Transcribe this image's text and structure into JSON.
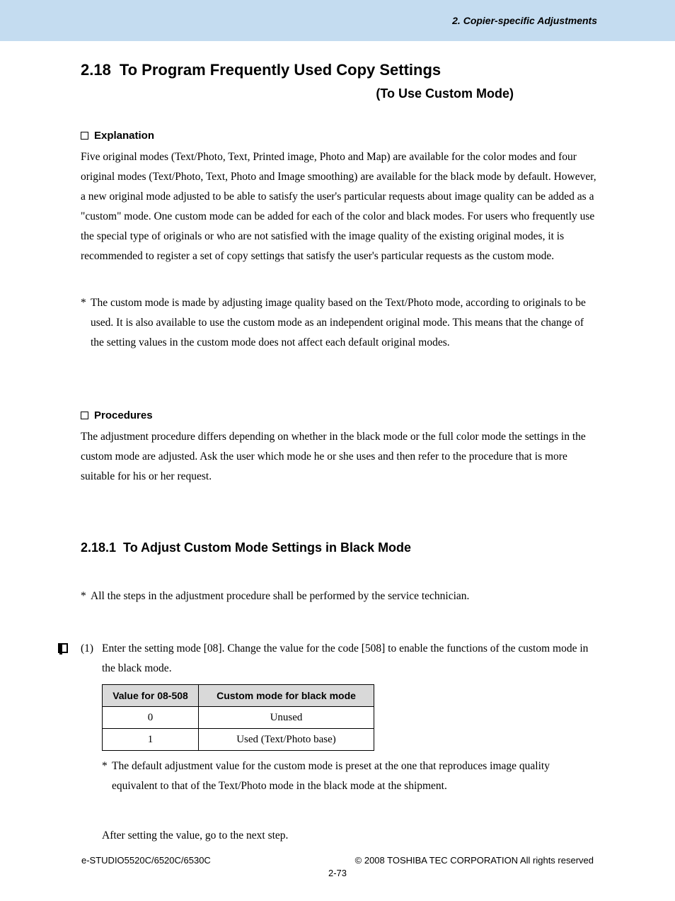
{
  "header": {
    "chapter": "2. Copier-specific Adjustments"
  },
  "title": {
    "number": "2.18",
    "text": "To Program Frequently Used Copy Settings",
    "subtitle": "(To Use Custom Mode)"
  },
  "explanation": {
    "label": "Explanation",
    "para": "Five original modes (Text/Photo, Text, Printed image, Photo and Map) are available for the color modes and four original modes (Text/Photo, Text, Photo and Image smoothing) are available for the black mode by default. However, a new original mode adjusted to be able to satisfy the user's particular requests about image quality can be added as a \"custom\" mode. One custom mode can be added for each of the color and black modes. For users who frequently use the special type of originals or who are not satisfied with the image quality of the existing original modes, it is recommended to register a set of copy settings that satisfy the user's particular requests as the custom mode.",
    "note": "The custom mode is made by adjusting image quality based on the Text/Photo mode, according to originals to be used. It is also available to use the custom mode as an independent original mode. This means that the change of the setting values in the custom mode does not affect each default original modes."
  },
  "procedures": {
    "label": "Procedures",
    "para": "The adjustment procedure differs depending on whether in the black mode or the full color mode the settings in the custom mode are adjusted. Ask the user which mode he or she uses and then refer to the procedure that is more suitable for his or her request."
  },
  "subsection": {
    "number": "2.18.1",
    "text": "To Adjust Custom Mode Settings in Black Mode",
    "all_steps_note": "All the steps in the adjustment procedure shall be performed by the service technician.",
    "step1": {
      "num": "(1)",
      "text": "Enter the setting mode [08]. Change the value for the code [508] to enable the functions of the custom mode in the black mode.",
      "table": {
        "headers": [
          "Value for 08-508",
          "Custom mode for black mode"
        ],
        "rows": [
          [
            "0",
            "Unused"
          ],
          [
            "1",
            "Used (Text/Photo base)"
          ]
        ]
      },
      "footnote": "The default adjustment value for the custom mode is preset at the one that reproduces image quality equivalent to that of the Text/Photo mode in the black mode at the shipment.",
      "after": "After setting the value, go to the next step."
    }
  },
  "footer": {
    "left": "e-STUDIO5520C/6520C/6530C",
    "right": "© 2008 TOSHIBA TEC CORPORATION All rights reserved",
    "page": "2-73"
  }
}
